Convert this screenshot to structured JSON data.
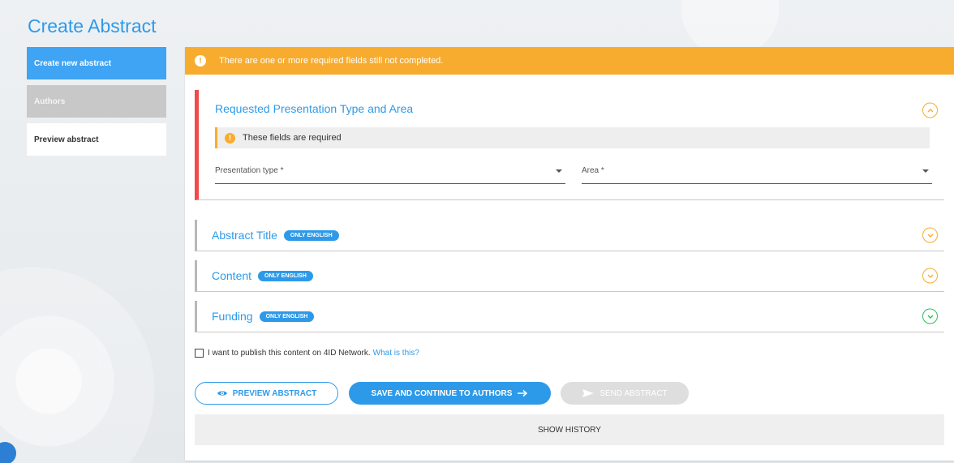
{
  "page": {
    "title": "Create Abstract"
  },
  "sidebar": {
    "items": [
      {
        "label": "Create new abstract",
        "state": "active"
      },
      {
        "label": "Authors",
        "state": "disabled"
      },
      {
        "label": "Preview abstract",
        "state": "normal"
      }
    ]
  },
  "alert": {
    "text": "There are one or more required fields still not completed.",
    "icon": "exclamation-icon"
  },
  "sections": {
    "presentation": {
      "title": "Requested Presentation Type and Area",
      "required_note": "These fields are required",
      "fields": {
        "presentation_type": "Presentation type *",
        "area": "Area *"
      }
    },
    "abstract_title": {
      "title": "Abstract Title",
      "badge": "ONLY ENGLISH"
    },
    "content": {
      "title": "Content",
      "badge": "ONLY ENGLISH"
    },
    "funding": {
      "title": "Funding",
      "badge": "ONLY ENGLISH"
    }
  },
  "publish": {
    "label": "I want to publish this content on 4ID Network.",
    "link": "What is this?",
    "checked": false
  },
  "buttons": {
    "preview": "PREVIEW ABSTRACT",
    "save": "SAVE AND CONTINUE TO AUTHORS",
    "send": "SEND ABSTRACT",
    "history": "SHOW HISTORY"
  },
  "colors": {
    "accent": "#2d9ae9",
    "warning": "#f8ac2f",
    "error": "#f24949",
    "success": "#2ebd59"
  }
}
